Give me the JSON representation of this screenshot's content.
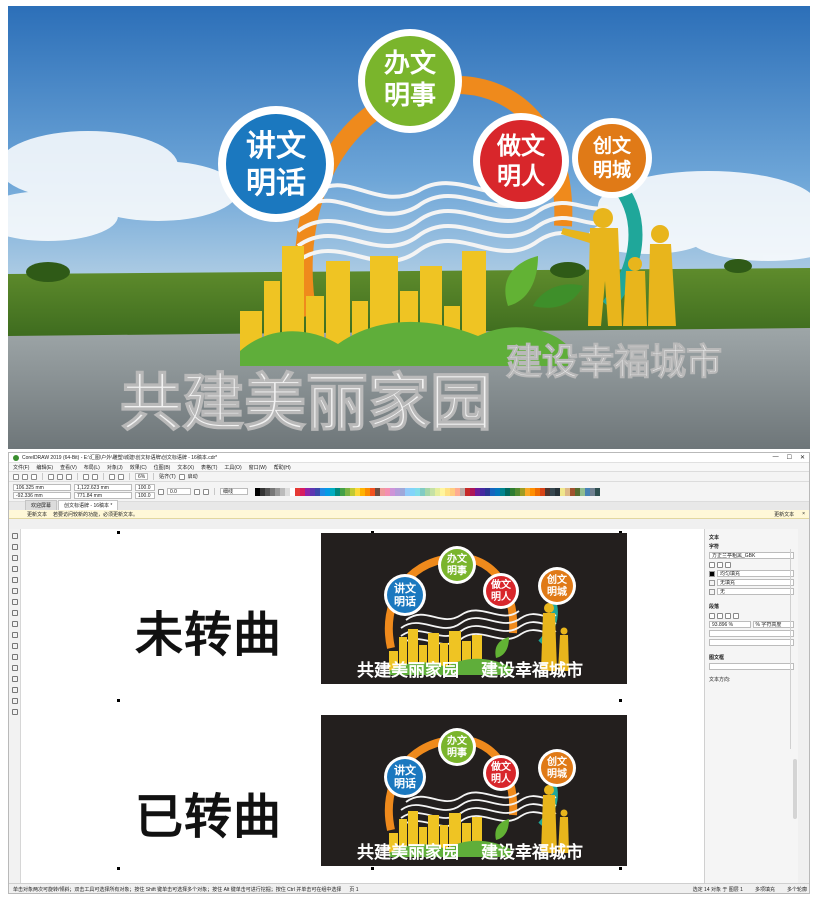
{
  "render": {
    "bubbles": [
      {
        "line1": "讲文",
        "line2": "明话",
        "color": "#1b78bf"
      },
      {
        "line1": "办文",
        "line2": "明事",
        "color": "#7ab52c"
      },
      {
        "line1": "做文",
        "line2": "明人",
        "color": "#d8262b"
      },
      {
        "line1": "创文",
        "line2": "明城",
        "color": "#e07a17"
      }
    ],
    "slogan_left": "共建美丽家园",
    "slogan_right": "建设幸福城市"
  },
  "app": {
    "title": "CorelDRAW 2019 (64-Bit) - E:\\汇图\\户外\\雕塑\\城建\\创文标语牌\\创文标语牌 - 16稿本.cdr*",
    "menu": [
      "文件(F)",
      "编辑(E)",
      "查看(V)",
      "布局(L)",
      "对象(J)",
      "效果(C)",
      "位图(B)",
      "文本(X)",
      "表格(T)",
      "工具(O)",
      "窗口(W)",
      "帮助(H)"
    ],
    "toolbar": {
      "zoom": "6%",
      "snap": "贴齐(T)",
      "launch": "启动"
    },
    "props": {
      "x": "106.325 mm",
      "y": "-92.336 mm",
      "w": "1,122.623 mm",
      "h": "771.84 mm",
      "sx": "100.0",
      "sy": "100.0",
      "angle": "0.0",
      "outline": "细线"
    },
    "tabs": [
      "欢迎屏幕",
      "创文标语牌 - 16稿本 *"
    ],
    "notice": {
      "label": "更新文本",
      "text": "若要访问较新的功能，必须更新文本。",
      "btn1": "更新文本",
      "btn2": "×"
    },
    "labels": {
      "not_converted": "未转曲",
      "converted": "已转曲"
    },
    "sidebar": {
      "panel": "文本",
      "char": "字符",
      "font": "方正兰亭粗黑_GBK",
      "fill": "均匀填充",
      "bg": "无填充",
      "outline": "无",
      "para": "段落",
      "spacing": "93.896 %",
      "spacing_unit": "% 字符高度",
      "frame": "图文框",
      "direction": "文本方向:"
    },
    "status": {
      "hint": "单击对象两次可旋转/倾斜；双击工具可选择所有对象；按住 Shift 键单击可选择多个对象；按住 Alt 键单击可进行挖掘；按住 Ctrl 并单击可在组中选择",
      "page": "页 1",
      "layer": "选定 14 对象 于 图层 1",
      "fill": "多项填充",
      "outline": "多个轮廓"
    }
  }
}
